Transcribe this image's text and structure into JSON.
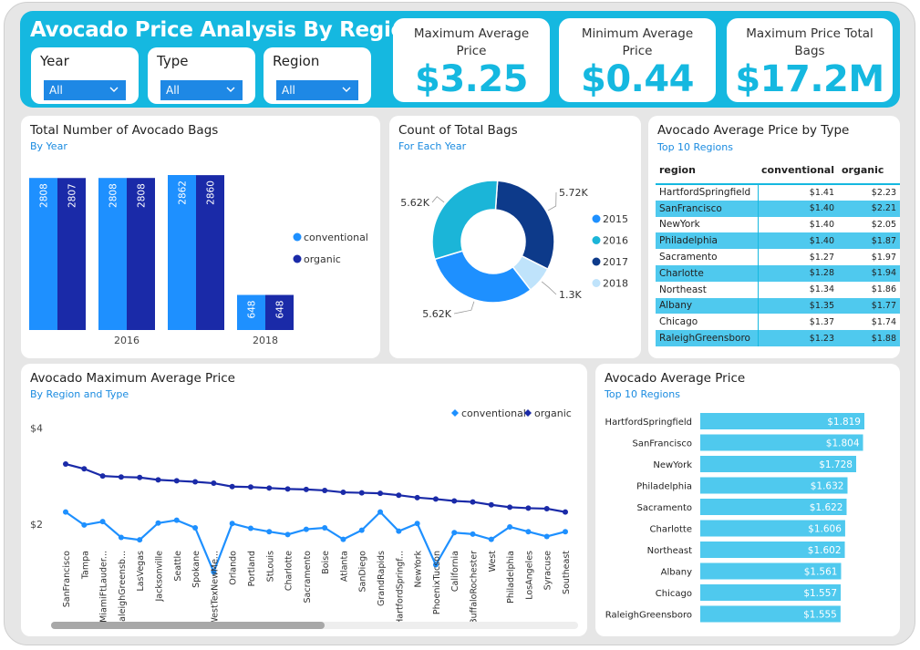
{
  "header": {
    "title": "Avocado Price Analysis By Region",
    "slicers": [
      {
        "label": "Year",
        "value": "All"
      },
      {
        "label": "Type",
        "value": "All"
      },
      {
        "label": "Region",
        "value": "All"
      }
    ],
    "kpis": [
      {
        "label": "Maximum Average Price",
        "value": "$3.25"
      },
      {
        "label": "Minimum Average Price",
        "value": "$0.44"
      },
      {
        "label": "Maximum Price Total Bags",
        "value": "$17.2M"
      }
    ]
  },
  "colors": {
    "accent": "#15b8e0",
    "conventional": "#1e90ff",
    "organic": "#1a2aa8",
    "slicer": "#1e88e5"
  },
  "chart_data": [
    {
      "id": "bags_by_year",
      "type": "bar",
      "title": "Total Number of Avocado Bags",
      "subtitle": "By Year",
      "categories": [
        "",
        "2016",
        "",
        "2018"
      ],
      "series": [
        {
          "name": "conventional",
          "values": [
            2808,
            2808,
            2862,
            648
          ]
        },
        {
          "name": "organic",
          "values": [
            2807,
            2808,
            2860,
            648
          ]
        }
      ],
      "legend": "right",
      "grid": false
    },
    {
      "id": "count_total_bags",
      "type": "pie",
      "title": "Count of Total Bags",
      "subtitle": "For Each Year",
      "slices": [
        {
          "label": "2017",
          "value": 5.72,
          "text": "5.72K",
          "color": "#0d3a8a"
        },
        {
          "label": "2018",
          "value": 1.3,
          "text": "1.3K",
          "color": "#bfe3fb"
        },
        {
          "label": "2015",
          "value": 5.62,
          "text": "5.62K",
          "color": "#1e90ff"
        },
        {
          "label": "2016",
          "value": 5.62,
          "text": "5.62K",
          "color": "#1bb5d8"
        }
      ],
      "legend_items": [
        {
          "label": "2015",
          "color": "#1e90ff"
        },
        {
          "label": "2016",
          "color": "#1bb5d8"
        },
        {
          "label": "2017",
          "color": "#0d3a8a"
        },
        {
          "label": "2018",
          "color": "#bfe3fb"
        }
      ]
    },
    {
      "id": "price_by_type",
      "type": "table",
      "title": "Avocado Average Price by Type",
      "subtitle": "Top 10 Regions",
      "columns": [
        "region",
        "conventional",
        "organic"
      ],
      "rows": [
        [
          "HartfordSpringfield",
          "$1.41",
          "$2.23"
        ],
        [
          "SanFrancisco",
          "$1.40",
          "$2.21"
        ],
        [
          "NewYork",
          "$1.40",
          "$2.05"
        ],
        [
          "Philadelphia",
          "$1.40",
          "$1.87"
        ],
        [
          "Sacramento",
          "$1.27",
          "$1.97"
        ],
        [
          "Charlotte",
          "$1.28",
          "$1.94"
        ],
        [
          "Northeast",
          "$1.34",
          "$1.86"
        ],
        [
          "Albany",
          "$1.35",
          "$1.77"
        ],
        [
          "Chicago",
          "$1.37",
          "$1.74"
        ],
        [
          "RaleighGreensboro",
          "$1.23",
          "$1.88"
        ]
      ]
    },
    {
      "id": "max_avg_price",
      "type": "line",
      "title": "Avocado Maximum Average Price",
      "subtitle": "By Region and Type",
      "x": [
        "SanFrancisco",
        "Tampa",
        "MiamiFtLauder...",
        "RaleighGreensb...",
        "LasVegas",
        "Jacksonville",
        "Seattle",
        "Spokane",
        "WestTexNewMe...",
        "Orlando",
        "Portland",
        "StLouis",
        "Charlotte",
        "Sacramento",
        "Boise",
        "Atlanta",
        "SanDiego",
        "GrandRapids",
        "HartfordSpringf...",
        "NewYork",
        "PhoenixTucson",
        "California",
        "BuffaloRochester",
        "West",
        "Philadelphia",
        "LosAngeles",
        "Syracuse",
        "Southeast"
      ],
      "series": [
        {
          "name": "conventional",
          "values": [
            2.25,
            1.98,
            2.05,
            1.72,
            1.67,
            2.02,
            2.08,
            1.92,
            1.0,
            2.01,
            1.91,
            1.84,
            1.78,
            1.89,
            1.92,
            1.68,
            1.87,
            2.25,
            1.85,
            2.01,
            1.15,
            1.82,
            1.79,
            1.68,
            1.94,
            1.84,
            1.74,
            1.84
          ]
        },
        {
          "name": "organic",
          "values": [
            3.25,
            3.15,
            3.0,
            2.98,
            2.97,
            2.92,
            2.9,
            2.88,
            2.85,
            2.78,
            2.77,
            2.75,
            2.73,
            2.72,
            2.7,
            2.66,
            2.65,
            2.64,
            2.6,
            2.55,
            2.52,
            2.48,
            2.46,
            2.4,
            2.35,
            2.33,
            2.32,
            2.25
          ]
        }
      ],
      "yticks": [
        "$4",
        "$2"
      ],
      "ytick_values": [
        4,
        2
      ],
      "ylim": [
        0.4,
        4.2
      ],
      "legend": "top-right"
    },
    {
      "id": "avg_price_region",
      "type": "bar",
      "orientation": "horizontal",
      "title": "Avocado Average Price",
      "subtitle": "Top 10 Regions",
      "categories": [
        "HartfordSpringfield",
        "SanFrancisco",
        "NewYork",
        "Philadelphia",
        "Sacramento",
        "Charlotte",
        "Northeast",
        "Albany",
        "Chicago",
        "RaleighGreensboro"
      ],
      "values": [
        1.819,
        1.804,
        1.728,
        1.632,
        1.622,
        1.606,
        1.602,
        1.561,
        1.557,
        1.555
      ],
      "labels": [
        "$1.819",
        "$1.804",
        "$1.728",
        "$1.632",
        "$1.622",
        "$1.606",
        "$1.602",
        "$1.561",
        "$1.557",
        "$1.555"
      ],
      "color": "#4fc9ee"
    }
  ]
}
